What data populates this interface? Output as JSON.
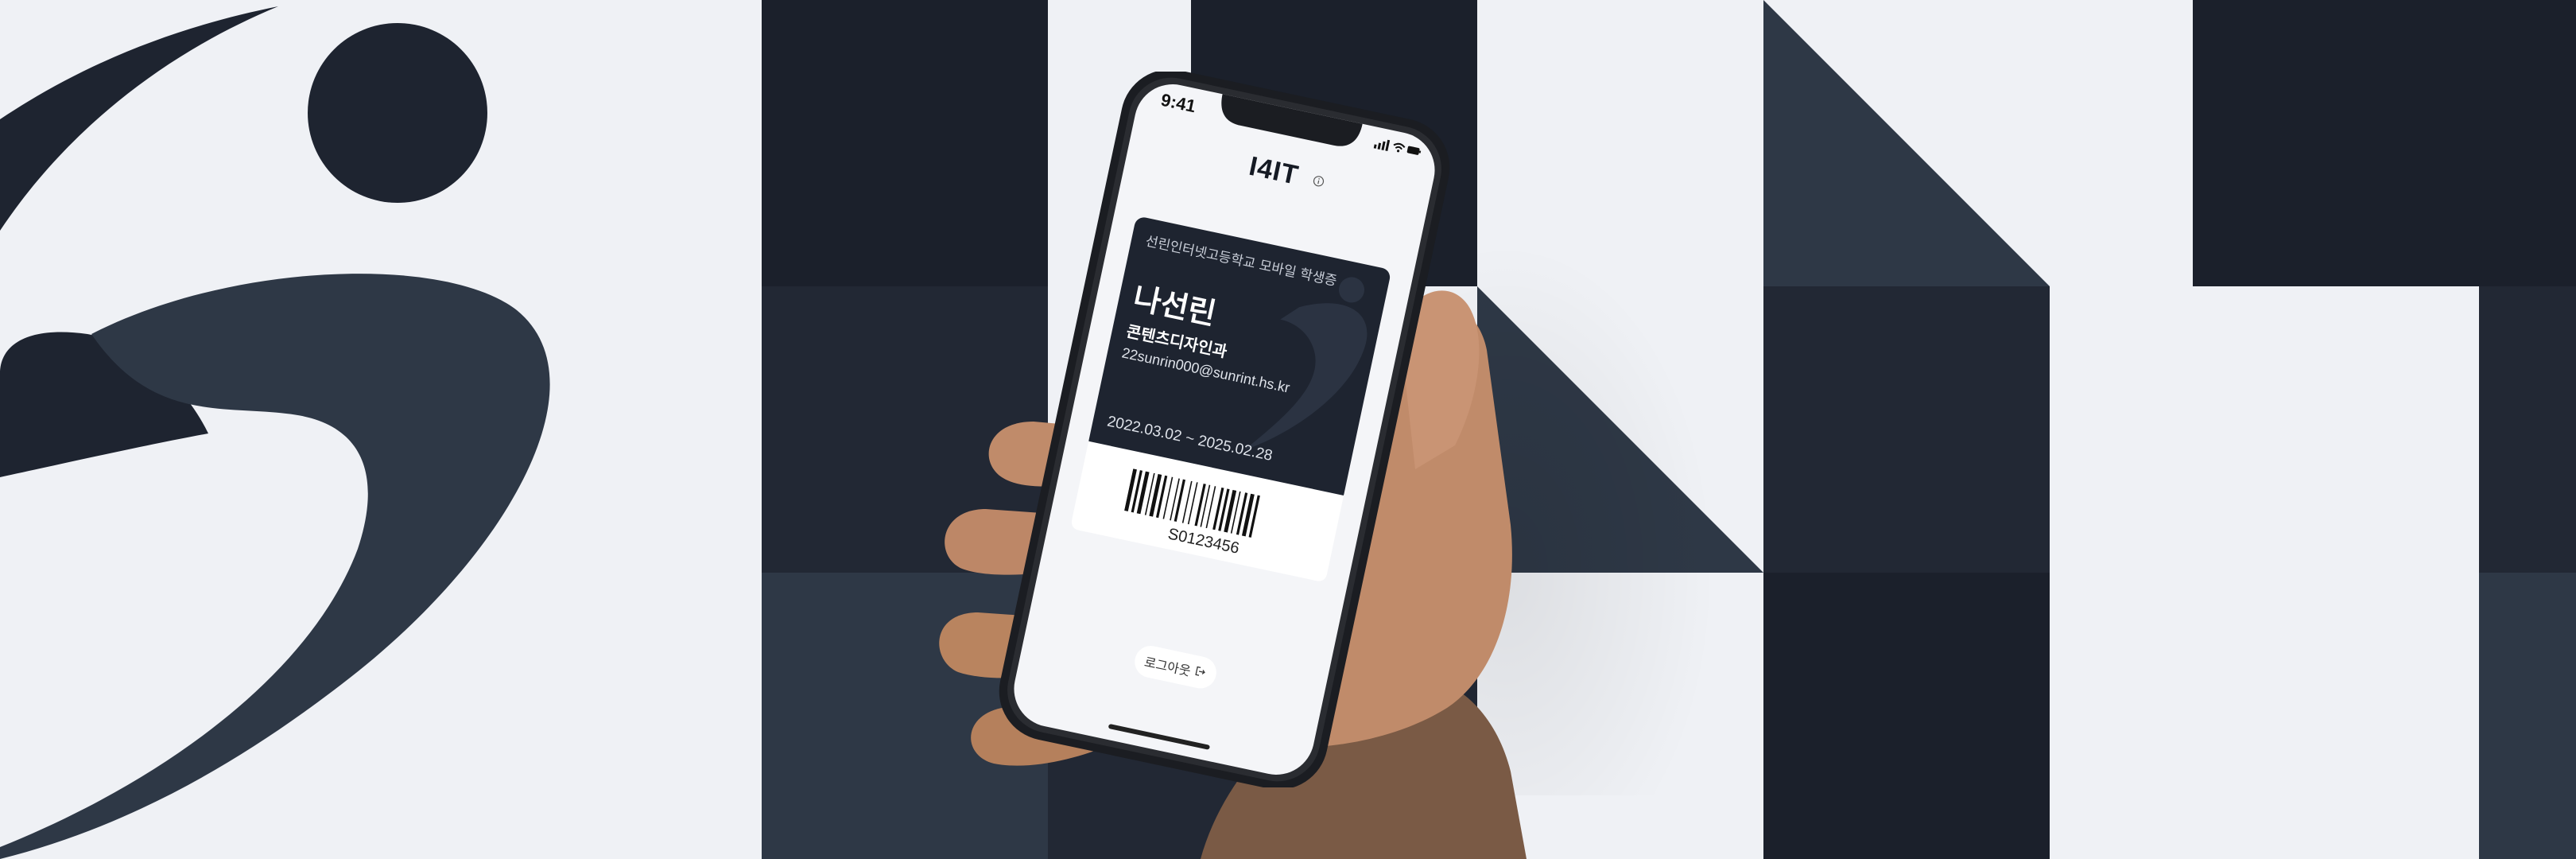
{
  "app": {
    "logo_text": "I4IT",
    "info_icon": "info-circle-icon"
  },
  "status_bar": {
    "time": "9:41",
    "icons": [
      "signal-icon",
      "wifi-icon",
      "battery-icon"
    ]
  },
  "student_card": {
    "school_caption": "선린인터넷고등학교 모바일 학생증",
    "name": "나선린",
    "department": "콘텐츠디자인과",
    "email": "22sunrin000@sunrint.hs.kr",
    "valid_period": "2022.03.02 ~ 2025.02.28",
    "barcode_number": "S0123456"
  },
  "logout_button": {
    "label": "로그아웃",
    "icon": "logout-icon"
  },
  "colors": {
    "background": "#eff1f5",
    "dark_navy": "#1b202b",
    "slate": "#2e3846",
    "card_dark": "#1e2430"
  }
}
